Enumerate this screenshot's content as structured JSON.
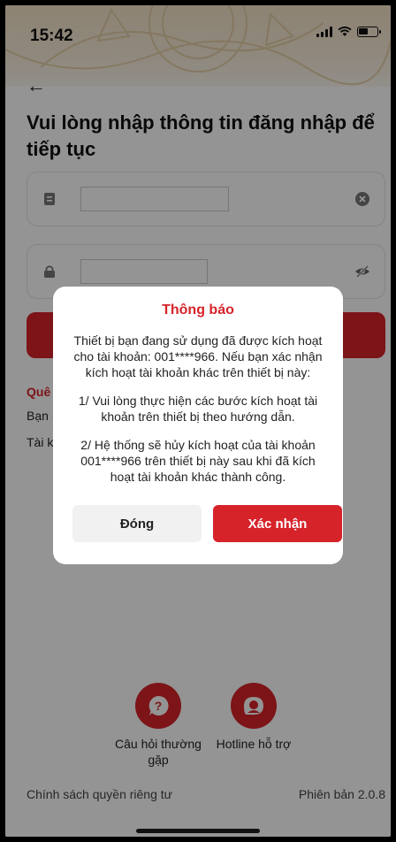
{
  "status_bar": {
    "time": "15:42"
  },
  "page": {
    "title": "Vui lòng nhập thông tin đăng nhập để tiếp tục"
  },
  "login_form": {
    "username_value": "",
    "password_value": ""
  },
  "partial_texts": {
    "forgot": "Quê",
    "line2": "Bạn",
    "line3": "Tài k"
  },
  "help": {
    "faq_label": "Câu hỏi thường gặp",
    "hotline_label": "Hotline hỗ trợ"
  },
  "footer": {
    "privacy": "Chính sách quyền riêng tư",
    "version": "Phiên bản 2.0.8"
  },
  "dialog": {
    "title": "Thông báo",
    "message": "Thiết bị bạn đang sử dụng đã được kích hoạt cho tài khoản: 001****966. Nếu bạn xác nhận kích hoạt tài khoản khác trên thiết bị này:",
    "step1": "1/ Vui lòng thực hiện các bước kích hoạt tài khoản trên thiết bị theo hướng dẫn.",
    "step2": "2/ Hệ thống sẽ hủy kích hoạt của tài khoản 001****966 trên thiết bị này sau khi đã kích hoạt tài khoản khác thành công.",
    "close_label": "Đóng",
    "confirm_label": "Xác nhận"
  },
  "colors": {
    "brand_red": "#d6232a",
    "header_gold": "#f3e3c8"
  },
  "icons": [
    "back-arrow-icon",
    "signal-icon",
    "wifi-icon",
    "battery-icon",
    "user-card-icon",
    "clear-icon",
    "lock-icon",
    "eye-off-icon",
    "question-icon",
    "hotline-icon"
  ]
}
